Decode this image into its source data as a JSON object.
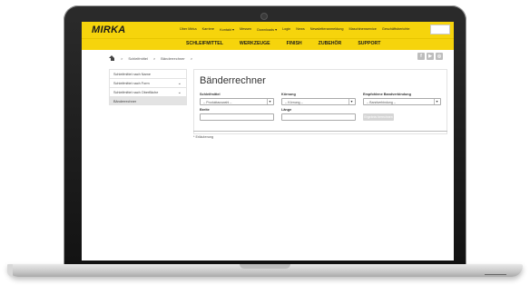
{
  "topbar": {
    "logo": "MIRKA",
    "links": [
      "Über Mirka",
      "Karriere",
      "Kontakt ▾",
      "Messen",
      "Downloads ▾",
      "Login",
      "News",
      "Newsletteranmeldung",
      "Maschinenservice",
      "Geschäftsberichte"
    ]
  },
  "mainnav": [
    "SCHLEIFMITTEL",
    "WERKZEUGE",
    "FINISH",
    "ZUBEHÖR",
    "SUPPORT"
  ],
  "breadcrumb": [
    "Schleifmittel",
    "Bänderrechner"
  ],
  "breadcrumb_sep": ">",
  "social": [
    "f",
    "▶",
    "◎"
  ],
  "sidebar": {
    "items": [
      {
        "label": "Schleifmittel nach Name",
        "chevron": ""
      },
      {
        "label": "Schleifmittel nach Form",
        "chevron": "⌄"
      },
      {
        "label": "Schleifmittel nach Oberfläche",
        "chevron": "⌄"
      },
      {
        "label": "Bänderrechner",
        "chevron": ""
      }
    ]
  },
  "calculator": {
    "title": "Bänderrechner",
    "schleifmittel_label": "Schleifmittel",
    "schleifmittel_value": "-- Produktauswahl --",
    "koernung_label": "Körnung",
    "koernung_value": "-- Körnung --",
    "empfohlene_label": "Empfohlene Bandverbindung",
    "empfohlene_value": "-- Bandverbindung --",
    "breite_label": "Breite",
    "laenge_label": "Länge",
    "button_label": "Ergebnis berechnen"
  },
  "note": "* Erläuterung",
  "colors": {
    "brand_yellow": "#f6d40c"
  }
}
